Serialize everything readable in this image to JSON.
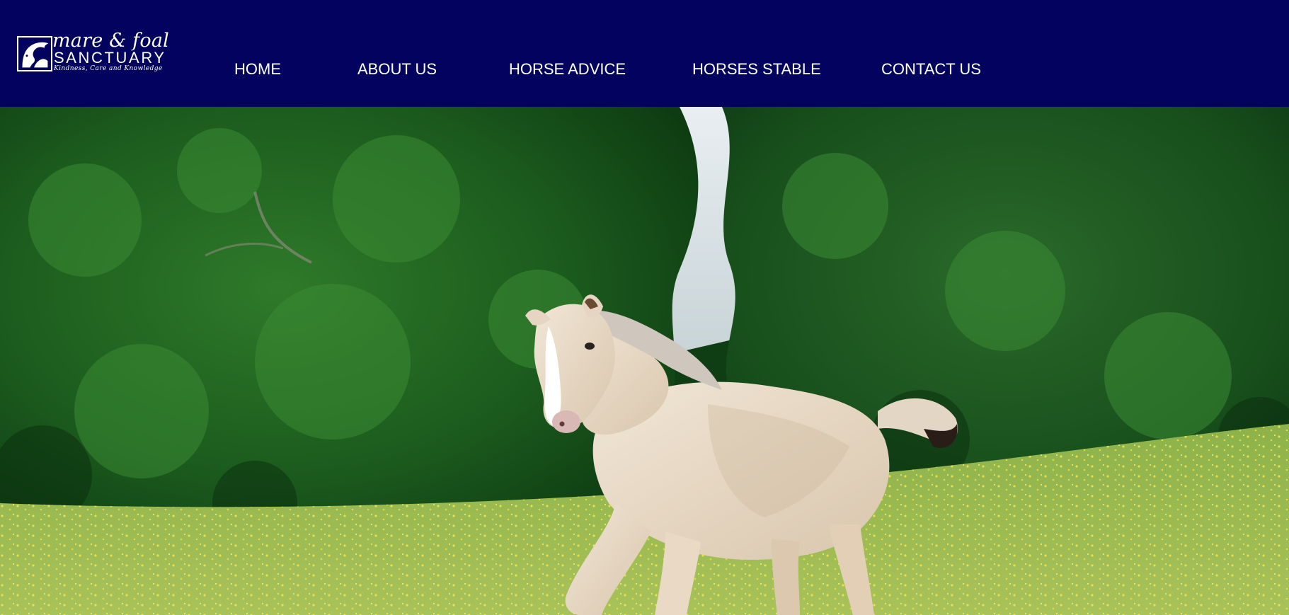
{
  "logo": {
    "line1": "mare & foal",
    "line2": "SANCTUARY",
    "tagline": "Kindness, Care and Knowledge",
    "icon": "horse-head-icon"
  },
  "nav": {
    "items": [
      {
        "label": "HOME"
      },
      {
        "label": "ABOUT US"
      },
      {
        "label": "HORSE ADVICE"
      },
      {
        "label": "HORSES STABLE"
      },
      {
        "label": "CONTACT US"
      }
    ]
  },
  "colors": {
    "header_bg": "#03035f",
    "nav_text": "#ffffff"
  },
  "hero": {
    "image": "foal-in-meadow-photo"
  }
}
